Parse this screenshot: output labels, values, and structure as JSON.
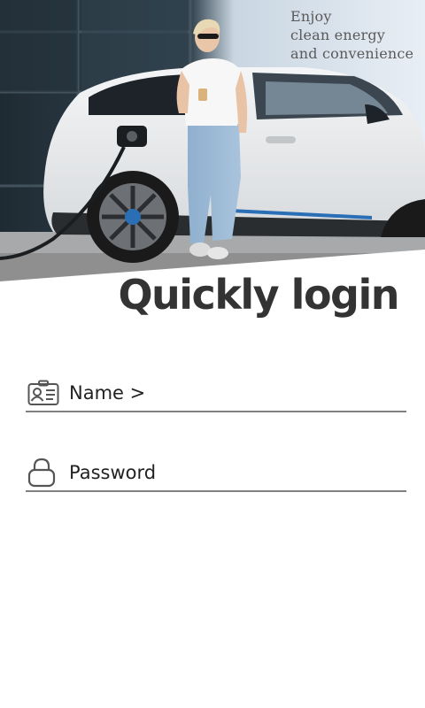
{
  "hero": {
    "tagline": [
      "Enjoy",
      "clean energy",
      "and convenience"
    ],
    "image_icon": "ev-charging-photo"
  },
  "login": {
    "title": "Quickly login",
    "name_field": {
      "label": "Name >",
      "icon": "id-card-icon"
    },
    "password_field": {
      "label": "Password",
      "icon": "lock-icon"
    }
  },
  "colors": {
    "title": "#333333",
    "underline": "#808080",
    "tagline": "#5a5a5a",
    "background": "#ffffff"
  }
}
